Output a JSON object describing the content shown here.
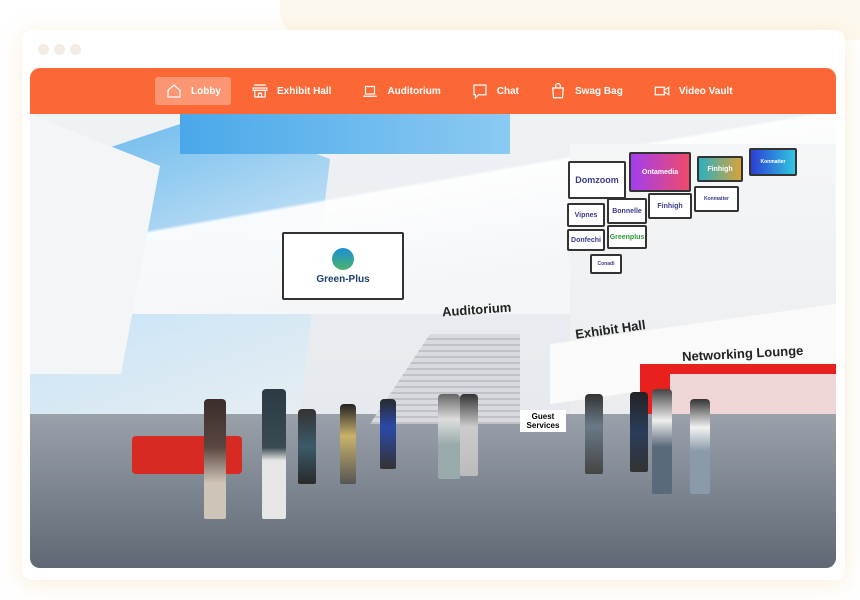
{
  "window": {
    "dots": 3
  },
  "nav": {
    "items": [
      {
        "label": "Lobby",
        "icon": "home-icon",
        "active": true
      },
      {
        "label": "Exhibit Hall",
        "icon": "storefront-icon"
      },
      {
        "label": "Auditorium",
        "icon": "laptop-icon"
      },
      {
        "label": "Chat",
        "icon": "chat-bubble-icon"
      },
      {
        "label": "Swag Bag",
        "icon": "shopping-bag-icon"
      },
      {
        "label": "Video Vault",
        "icon": "video-camera-icon"
      }
    ],
    "color": "#fb6835"
  },
  "scene": {
    "monitor": "Green-Plus",
    "auditorium": "Auditorium",
    "exhibit_hall": "Exhibit Hall",
    "networking": "Networking Lounge",
    "guest_services": "Guest Services",
    "sponsors": [
      "Domzoom",
      "Ontamedia",
      "Finhigh",
      "Konmatter",
      "Vipnes",
      "Bonnelle",
      "Finhigh",
      "Konmatter",
      "Donfechi",
      "Greenplus",
      "Conadi"
    ]
  }
}
